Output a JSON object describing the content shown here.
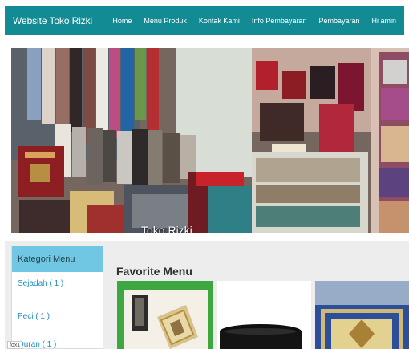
{
  "navbar": {
    "brand": "Website Toko Rizki",
    "links": [
      {
        "label": "Home"
      },
      {
        "label": "Menu Produk"
      },
      {
        "label": "Kontak Kami"
      },
      {
        "label": "Info Pembayaran"
      },
      {
        "label": "Pembayaran"
      },
      {
        "label": "Hi amin"
      }
    ],
    "background_color": "#128b95"
  },
  "hero": {
    "caption": "Toko Rizki"
  },
  "sidebar": {
    "title": "Kategori Menu",
    "items": [
      {
        "label": "Sejadah ( 1 )"
      },
      {
        "label": "Peci ( 1 )"
      },
      {
        "label": "Quran ( 1 )"
      }
    ],
    "title_background": "#6fc7e3",
    "link_color": "#1f8fbd"
  },
  "main": {
    "title": "Favorite Menu",
    "products": [
      {
        "icon": "prayer-mat-image"
      },
      {
        "icon": "peci-image"
      },
      {
        "icon": "prayer-rug-image"
      }
    ]
  },
  "tooltip": {
    "text": "fdx1"
  }
}
